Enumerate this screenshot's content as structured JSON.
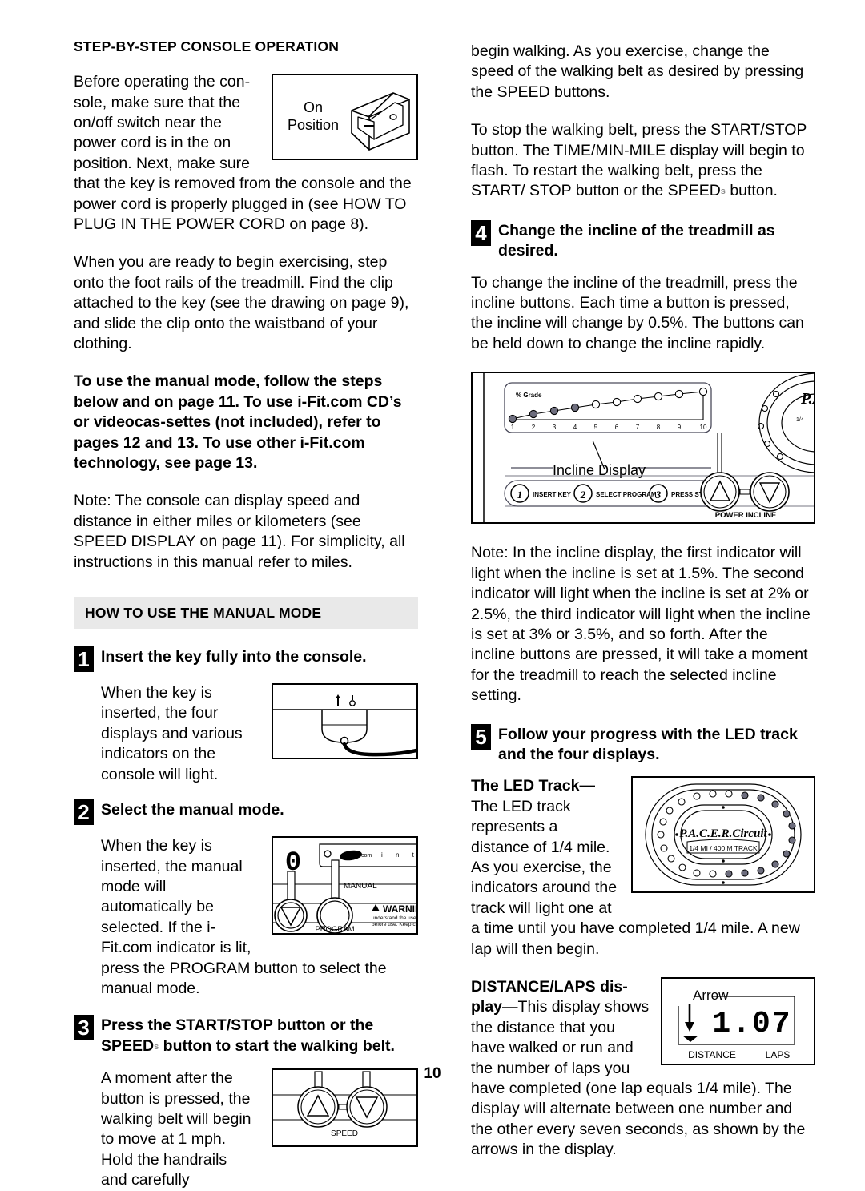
{
  "page": {
    "number": "10"
  },
  "left": {
    "title": "STEP-BY-STEP CONSOLE OPERATION",
    "intro_wrapped": "Before operating the con-\nsole, make sure that the\non/off switch near the\npower cord is in the on\nposition. Next, make sure\nthat the key is removed",
    "intro_rest": "from the console and the power cord is properly plugged in (see HOW TO PLUG IN THE POWER CORD on page 8).",
    "para2": "When you are ready to begin exercising, step onto the foot rails of the treadmill. Find the clip attached to the key (see the drawing on page 9), and slide the clip onto the waistband of your clothing.",
    "para3_bold": "To use the manual mode, follow the steps below and on page 11. To use i-Fit.com CD’s or videocas-settes (not included), refer to pages 12 and 13. To use other i-Fit.com technology, see page 13.",
    "para4": "Note: The console can display speed and distance in either miles or kilometers (see SPEED DISPLAY on page 11). For simplicity, all instructions in this manual refer to miles.",
    "band_title": "HOW TO USE THE MANUAL MODE",
    "switch_fig": {
      "label_line1": "On",
      "label_line2": "Position"
    },
    "steps": [
      {
        "number": "1",
        "heading": "Insert the key fully into the console.",
        "body": "When the key is inserted, the four displays and various indicators on the console will light."
      },
      {
        "number": "2",
        "heading": "Select the manual mode.",
        "body": "When the key is inserted, the manual mode will automatically be selected. If the i-Fit.com indicator is lit, press the PROGRAM button to select the manual mode."
      },
      {
        "number": "3",
        "heading_part1": "Press the START/STOP button or the SPEED",
        "heading_symbol": "s",
        "heading_part2": "button to start the walking belt.",
        "body": "A moment after the button is pressed, the walking belt will begin to move at 1 mph. Hold the handrails and carefully"
      }
    ],
    "console_fig": {
      "digit": "0",
      "brand": "i-Fit.com",
      "manual_label": "MANUAL",
      "program_label": "PROGRAM",
      "warning_label": "WARNING",
      "warning_line1": "understand the user",
      "warning_line2": "before use.  Keep ch",
      "right_letters": "i      n      t"
    },
    "speed_fig": {
      "label": "SPEED"
    }
  },
  "right": {
    "para1": "begin walking. As you exercise, change the speed of the walking belt as desired by pressing the SPEED buttons.",
    "para2_part1": "To stop the walking belt, press the START/STOP button. The TIME/MIN-MILE display will begin to flash. To restart the walking belt, press the START/ STOP button or the SPEED",
    "para2_symbol": "s",
    "para2_part2": "button.",
    "steps": [
      {
        "number": "4",
        "heading": "Change the incline of the treadmill as desired.",
        "body": "To change the incline of the treadmill, press the incline buttons. Each time a button is pressed, the incline will change by 0.5%. The buttons can be held down to change the incline rapidly."
      },
      {
        "number": "5",
        "heading": "Follow your progress with the LED track and the four displays."
      }
    ],
    "incline_fig": {
      "grade_label": "% Grade",
      "ticks": [
        "1",
        "2",
        "3",
        "4",
        "5",
        "6",
        "7",
        "8",
        "9",
        "10"
      ],
      "filled_count": 4,
      "callout": "Incline Display",
      "prompt_1_num": "1",
      "prompt_1_text": "INSERT KEY",
      "prompt_2_num": "2",
      "prompt_2_text": "SELECT PROGRAM",
      "prompt_3_num": "3",
      "prompt_3_text": "PRESS START",
      "power_incline_label": "POWER INCLINE",
      "pacer_text": "P.A.C.E.R.Circuit",
      "pacer_sub": "1/4"
    },
    "note_incline": "Note: In the incline display, the first indicator will light when the incline is set at 1.5%. The second indicator will light when the incline is set at 2% or 2.5%, the third indicator will light when the incline is set at 3% or 3.5%, and so forth. After the incline buttons are pressed, it will take a moment for the treadmill to reach the selected incline setting.",
    "led_track": {
      "heading": "The LED Track—",
      "body_wrapped": "The LED track represents a distance of 1/4 mile. As you exercise, the indicators around the track will light one at a",
      "body_rest": "time until you have completed 1/4 mile. A new lap will then begin.",
      "fig": {
        "pacer_text": "P.A.C.E.R.Circuit",
        "track_text": "1/4 MI / 400 M TRACK",
        "total_leds": 28,
        "lit_leds": 13
      }
    },
    "distance_laps": {
      "heading_part1": "DISTANCE/LAPS dis-",
      "heading_part2": "play",
      "dash": "—",
      "body_wrapped": "This display shows the distance that you have walked or run and the number of laps you have completed (one lap",
      "body_rest": "equals 1/4 mile. The display will alternate between one number and the other every seven seconds, as shown by the arrows in the display.",
      "body_rest_fixed": "equals 1/4 mile). The display will alternate between one number and the other every seven seconds, as shown by the arrows in the display.",
      "fig": {
        "arrow_label": "Arrow",
        "value": "1.07",
        "label_left": "DISTANCE",
        "label_right": "LAPS"
      }
    }
  },
  "colors": {
    "band_bg": "#e9e9e9",
    "ink": "#000000",
    "led_lit": "#7a7a8a",
    "symbol_grey": "#8d8d8d"
  }
}
